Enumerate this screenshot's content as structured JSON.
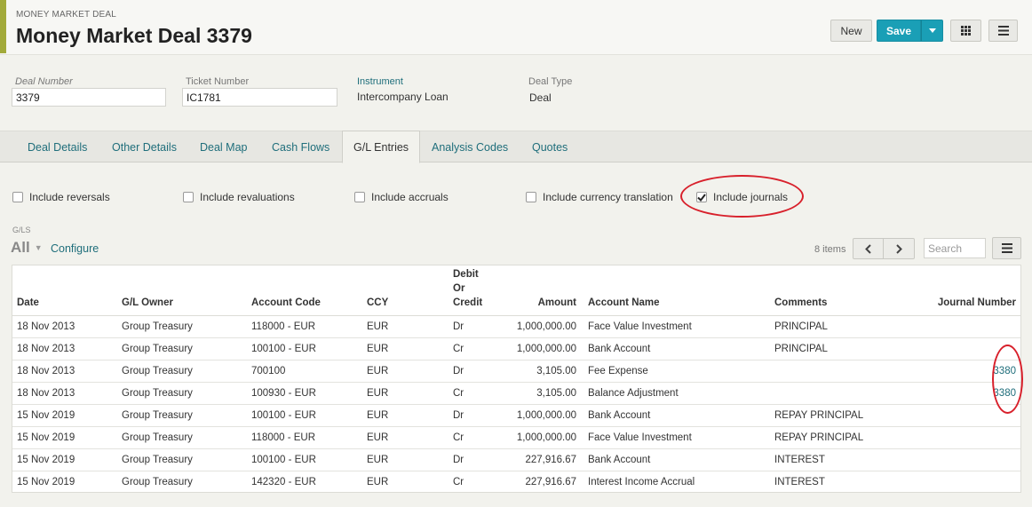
{
  "header": {
    "subtitle": "MONEY MARKET DEAL",
    "title": "Money Market Deal 3379",
    "new_label": "New",
    "save_label": "Save"
  },
  "fields": {
    "deal_number_label": "Deal Number",
    "deal_number_value": "3379",
    "ticket_number_label": "Ticket Number",
    "ticket_number_value": "IC1781",
    "instrument_label": "Instrument",
    "instrument_value": "Intercompany Loan",
    "deal_type_label": "Deal Type",
    "deal_type_value": "Deal"
  },
  "tabs": [
    {
      "label": "Deal Details",
      "active": false
    },
    {
      "label": "Other Details",
      "active": false
    },
    {
      "label": "Deal Map",
      "active": false
    },
    {
      "label": "Cash Flows",
      "active": false
    },
    {
      "label": "G/L Entries",
      "active": true
    },
    {
      "label": "Analysis Codes",
      "active": false
    },
    {
      "label": "Quotes",
      "active": false
    }
  ],
  "filters": [
    {
      "label": "Include reversals",
      "checked": false
    },
    {
      "label": "Include revaluations",
      "checked": false
    },
    {
      "label": "Include accruals",
      "checked": false
    },
    {
      "label": "Include currency translation",
      "checked": false
    },
    {
      "label": "Include journals",
      "checked": true
    }
  ],
  "grid": {
    "section_label": "G/LS",
    "view_label": "All",
    "configure_label": "Configure",
    "items_count": "8 items",
    "search_placeholder": "Search",
    "columns": [
      "Date",
      "G/L Owner",
      "Account Code",
      "CCY",
      "Debit\nOr\nCredit",
      "Amount",
      "Account Name",
      "Comments",
      "Journal Number"
    ],
    "rows": [
      [
        "18 Nov 2013",
        "Group Treasury",
        "118000 - EUR",
        "EUR",
        "Dr",
        "1,000,000.00",
        "Face Value Investment",
        "PRINCIPAL",
        ""
      ],
      [
        "18 Nov 2013",
        "Group Treasury",
        "100100 - EUR",
        "EUR",
        "Cr",
        "1,000,000.00",
        "Bank Account",
        "PRINCIPAL",
        ""
      ],
      [
        "18 Nov 2013",
        "Group Treasury",
        "700100",
        "EUR",
        "Dr",
        "3,105.00",
        "Fee Expense",
        "",
        "3380"
      ],
      [
        "18 Nov 2013",
        "Group Treasury",
        "100930 - EUR",
        "EUR",
        "Cr",
        "3,105.00",
        "Balance Adjustment",
        "",
        "3380"
      ],
      [
        "15 Nov 2019",
        "Group Treasury",
        "100100 - EUR",
        "EUR",
        "Dr",
        "1,000,000.00",
        "Bank Account",
        "REPAY PRINCIPAL",
        ""
      ],
      [
        "15 Nov 2019",
        "Group Treasury",
        "118000 - EUR",
        "EUR",
        "Cr",
        "1,000,000.00",
        "Face Value Investment",
        "REPAY PRINCIPAL",
        ""
      ],
      [
        "15 Nov 2019",
        "Group Treasury",
        "100100 - EUR",
        "EUR",
        "Dr",
        "227,916.67",
        "Bank Account",
        "INTEREST",
        ""
      ],
      [
        "15 Nov 2019",
        "Group Treasury",
        "142320 - EUR",
        "EUR",
        "Cr",
        "227,916.67",
        "Interest Income Accrual",
        "INTEREST",
        ""
      ]
    ]
  },
  "colors": {
    "accent": "#a2aa3a",
    "save_button": "#1a9fb6",
    "link": "#1f6e7b",
    "highlight_ring": "#d8202b"
  }
}
